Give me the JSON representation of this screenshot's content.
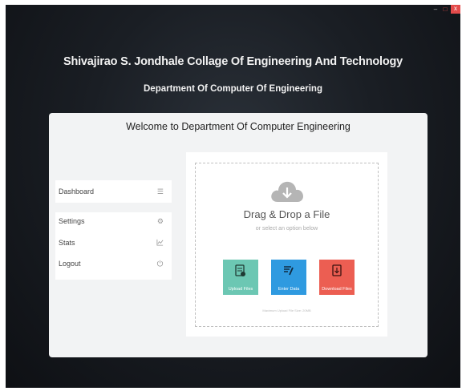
{
  "window": {
    "controls": {
      "minimize": "–",
      "maximize": "□",
      "close": "x"
    }
  },
  "header": {
    "college": "Shivajirao S. Jondhale Collage Of Engineering And Technology",
    "department": "Department Of Computer Of Engineering"
  },
  "panel": {
    "welcome": "Welcome to Department Of Computer Engineering"
  },
  "sidebar": {
    "items": [
      {
        "label": "Dashboard",
        "icon": "menu-icon",
        "glyph": "☰"
      },
      {
        "label": "Settings",
        "icon": "gear-icon",
        "glyph": "⚙"
      },
      {
        "label": "Stats",
        "icon": "chart-icon",
        "glyph": "⩘"
      },
      {
        "label": "Logout",
        "icon": "power-icon",
        "glyph": "⏻"
      }
    ]
  },
  "upload": {
    "title": "Drag & Drop a File",
    "subtitle": "or select an option below",
    "buttons": {
      "upload": "Upload Files",
      "enter": "Enter Data",
      "download": "Download Files"
    },
    "footnote": "Maximum Upload File Size: 20MB"
  },
  "colors": {
    "upload_button": "#6cc7b3",
    "enter_button": "#2f9ae0",
    "download_button": "#ec5e52",
    "close_button": "#e34b4b"
  }
}
